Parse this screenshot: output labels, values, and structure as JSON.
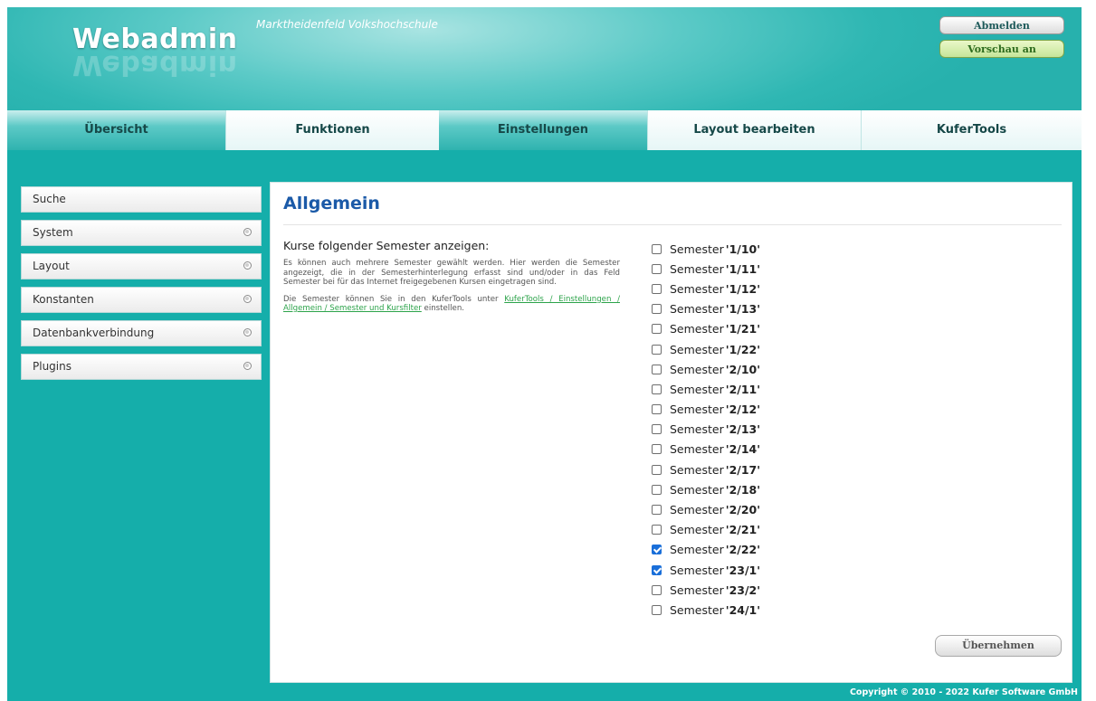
{
  "header": {
    "logo_text": "Webadmin",
    "site_name": "Marktheidenfeld Volkshochschule",
    "logout_label": "Abmelden",
    "preview_label": "Vorschau an"
  },
  "nav": {
    "tabs": [
      {
        "label": "Übersicht",
        "active": true
      },
      {
        "label": "Funktionen",
        "active": false
      },
      {
        "label": "Einstellungen",
        "active": true
      },
      {
        "label": "Layout bearbeiten",
        "active": false
      },
      {
        "label": "KuferTools",
        "active": false
      }
    ]
  },
  "sidebar": {
    "items": [
      {
        "label": "Suche"
      },
      {
        "label": "System"
      },
      {
        "label": "Layout"
      },
      {
        "label": "Konstanten"
      },
      {
        "label": "Datenbankverbindung"
      },
      {
        "label": "Plugins"
      }
    ]
  },
  "main": {
    "title": "Allgemein",
    "section_heading": "Kurse folgender Semester anzeigen:",
    "desc_p1": "Es können auch mehrere Semester gewählt werden. Hier werden die Semester angezeigt, die in der Semesterhinterlegung erfasst sind und/oder in das Feld Semester bei für das Internet freigegebenen Kursen eingetragen sind.",
    "desc_p2_prefix": "Die Semester können Sie in den KuferTools unter ",
    "desc_p2_link": "KuferTools / Einstellungen / Allgemein / Semester und Kursfilter",
    "desc_p2_suffix": " einstellen.",
    "semester_prefix": "Semester",
    "semesters": [
      {
        "code": "'1/10'",
        "checked": false
      },
      {
        "code": "'1/11'",
        "checked": false
      },
      {
        "code": "'1/12'",
        "checked": false
      },
      {
        "code": "'1/13'",
        "checked": false
      },
      {
        "code": "'1/21'",
        "checked": false
      },
      {
        "code": "'1/22'",
        "checked": false
      },
      {
        "code": "'2/10'",
        "checked": false
      },
      {
        "code": "'2/11'",
        "checked": false
      },
      {
        "code": "'2/12'",
        "checked": false
      },
      {
        "code": "'2/13'",
        "checked": false
      },
      {
        "code": "'2/14'",
        "checked": false
      },
      {
        "code": "'2/17'",
        "checked": false
      },
      {
        "code": "'2/18'",
        "checked": false
      },
      {
        "code": "'2/20'",
        "checked": false
      },
      {
        "code": "'2/21'",
        "checked": false
      },
      {
        "code": "'2/22'",
        "checked": true
      },
      {
        "code": "'23/1'",
        "checked": true
      },
      {
        "code": "'23/2'",
        "checked": false
      },
      {
        "code": "'24/1'",
        "checked": false
      }
    ],
    "apply_label": "Übernehmen"
  },
  "footer": {
    "copyright": "Copyright © 2010 - 2022 Kufer Software GmbH"
  }
}
